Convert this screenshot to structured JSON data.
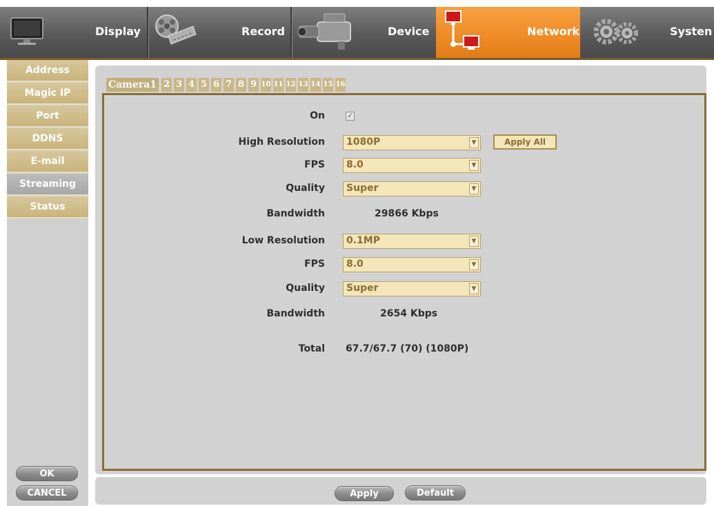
{
  "nav": {
    "tabs": [
      {
        "label": "Display",
        "icon": "monitor-icon"
      },
      {
        "label": "Record",
        "icon": "film-reel-icon"
      },
      {
        "label": "Device",
        "icon": "camcorder-icon"
      },
      {
        "label": "Network",
        "icon": "network-icon",
        "active": true
      },
      {
        "label": "Systen",
        "icon": "gears-icon"
      }
    ]
  },
  "sidebar": {
    "items": [
      {
        "label": "Address"
      },
      {
        "label": "Magic IP"
      },
      {
        "label": "Port"
      },
      {
        "label": "DDNS"
      },
      {
        "label": "E-mail"
      },
      {
        "label": "Streaming",
        "active": true
      },
      {
        "label": "Status"
      }
    ],
    "ok_label": "OK",
    "cancel_label": "CANCEL"
  },
  "camera_tabs": [
    "Camera1",
    "2",
    "3",
    "4",
    "5",
    "6",
    "7",
    "8",
    "9",
    "10",
    "11",
    "12",
    "13",
    "14",
    "15",
    "16"
  ],
  "form": {
    "on_label": "On",
    "on_checked": true,
    "high": {
      "resolution_label": "High Resolution",
      "resolution_value": "1080P",
      "fps_label": "FPS",
      "fps_value": "8.0",
      "quality_label": "Quality",
      "quality_value": "Super",
      "bandwidth_label": "Bandwidth",
      "bandwidth_value": "29866 Kbps"
    },
    "apply_all_label": "Apply All",
    "low": {
      "resolution_label": "Low Resolution",
      "resolution_value": "0.1MP",
      "fps_label": "FPS",
      "fps_value": "8.0",
      "quality_label": "Quality",
      "quality_value": "Super",
      "bandwidth_label": "Bandwidth",
      "bandwidth_value": "2654 Kbps"
    },
    "total_label": "Total",
    "total_value": "67.7/67.7 (70) (1080P)"
  },
  "actions": {
    "apply_label": "Apply",
    "default_label": "Default"
  },
  "colors": {
    "accent": "#ee8b25",
    "tab_gold": "#c9b787",
    "field_bg": "#f4e6b8",
    "border_brown": "#8a6d35"
  }
}
